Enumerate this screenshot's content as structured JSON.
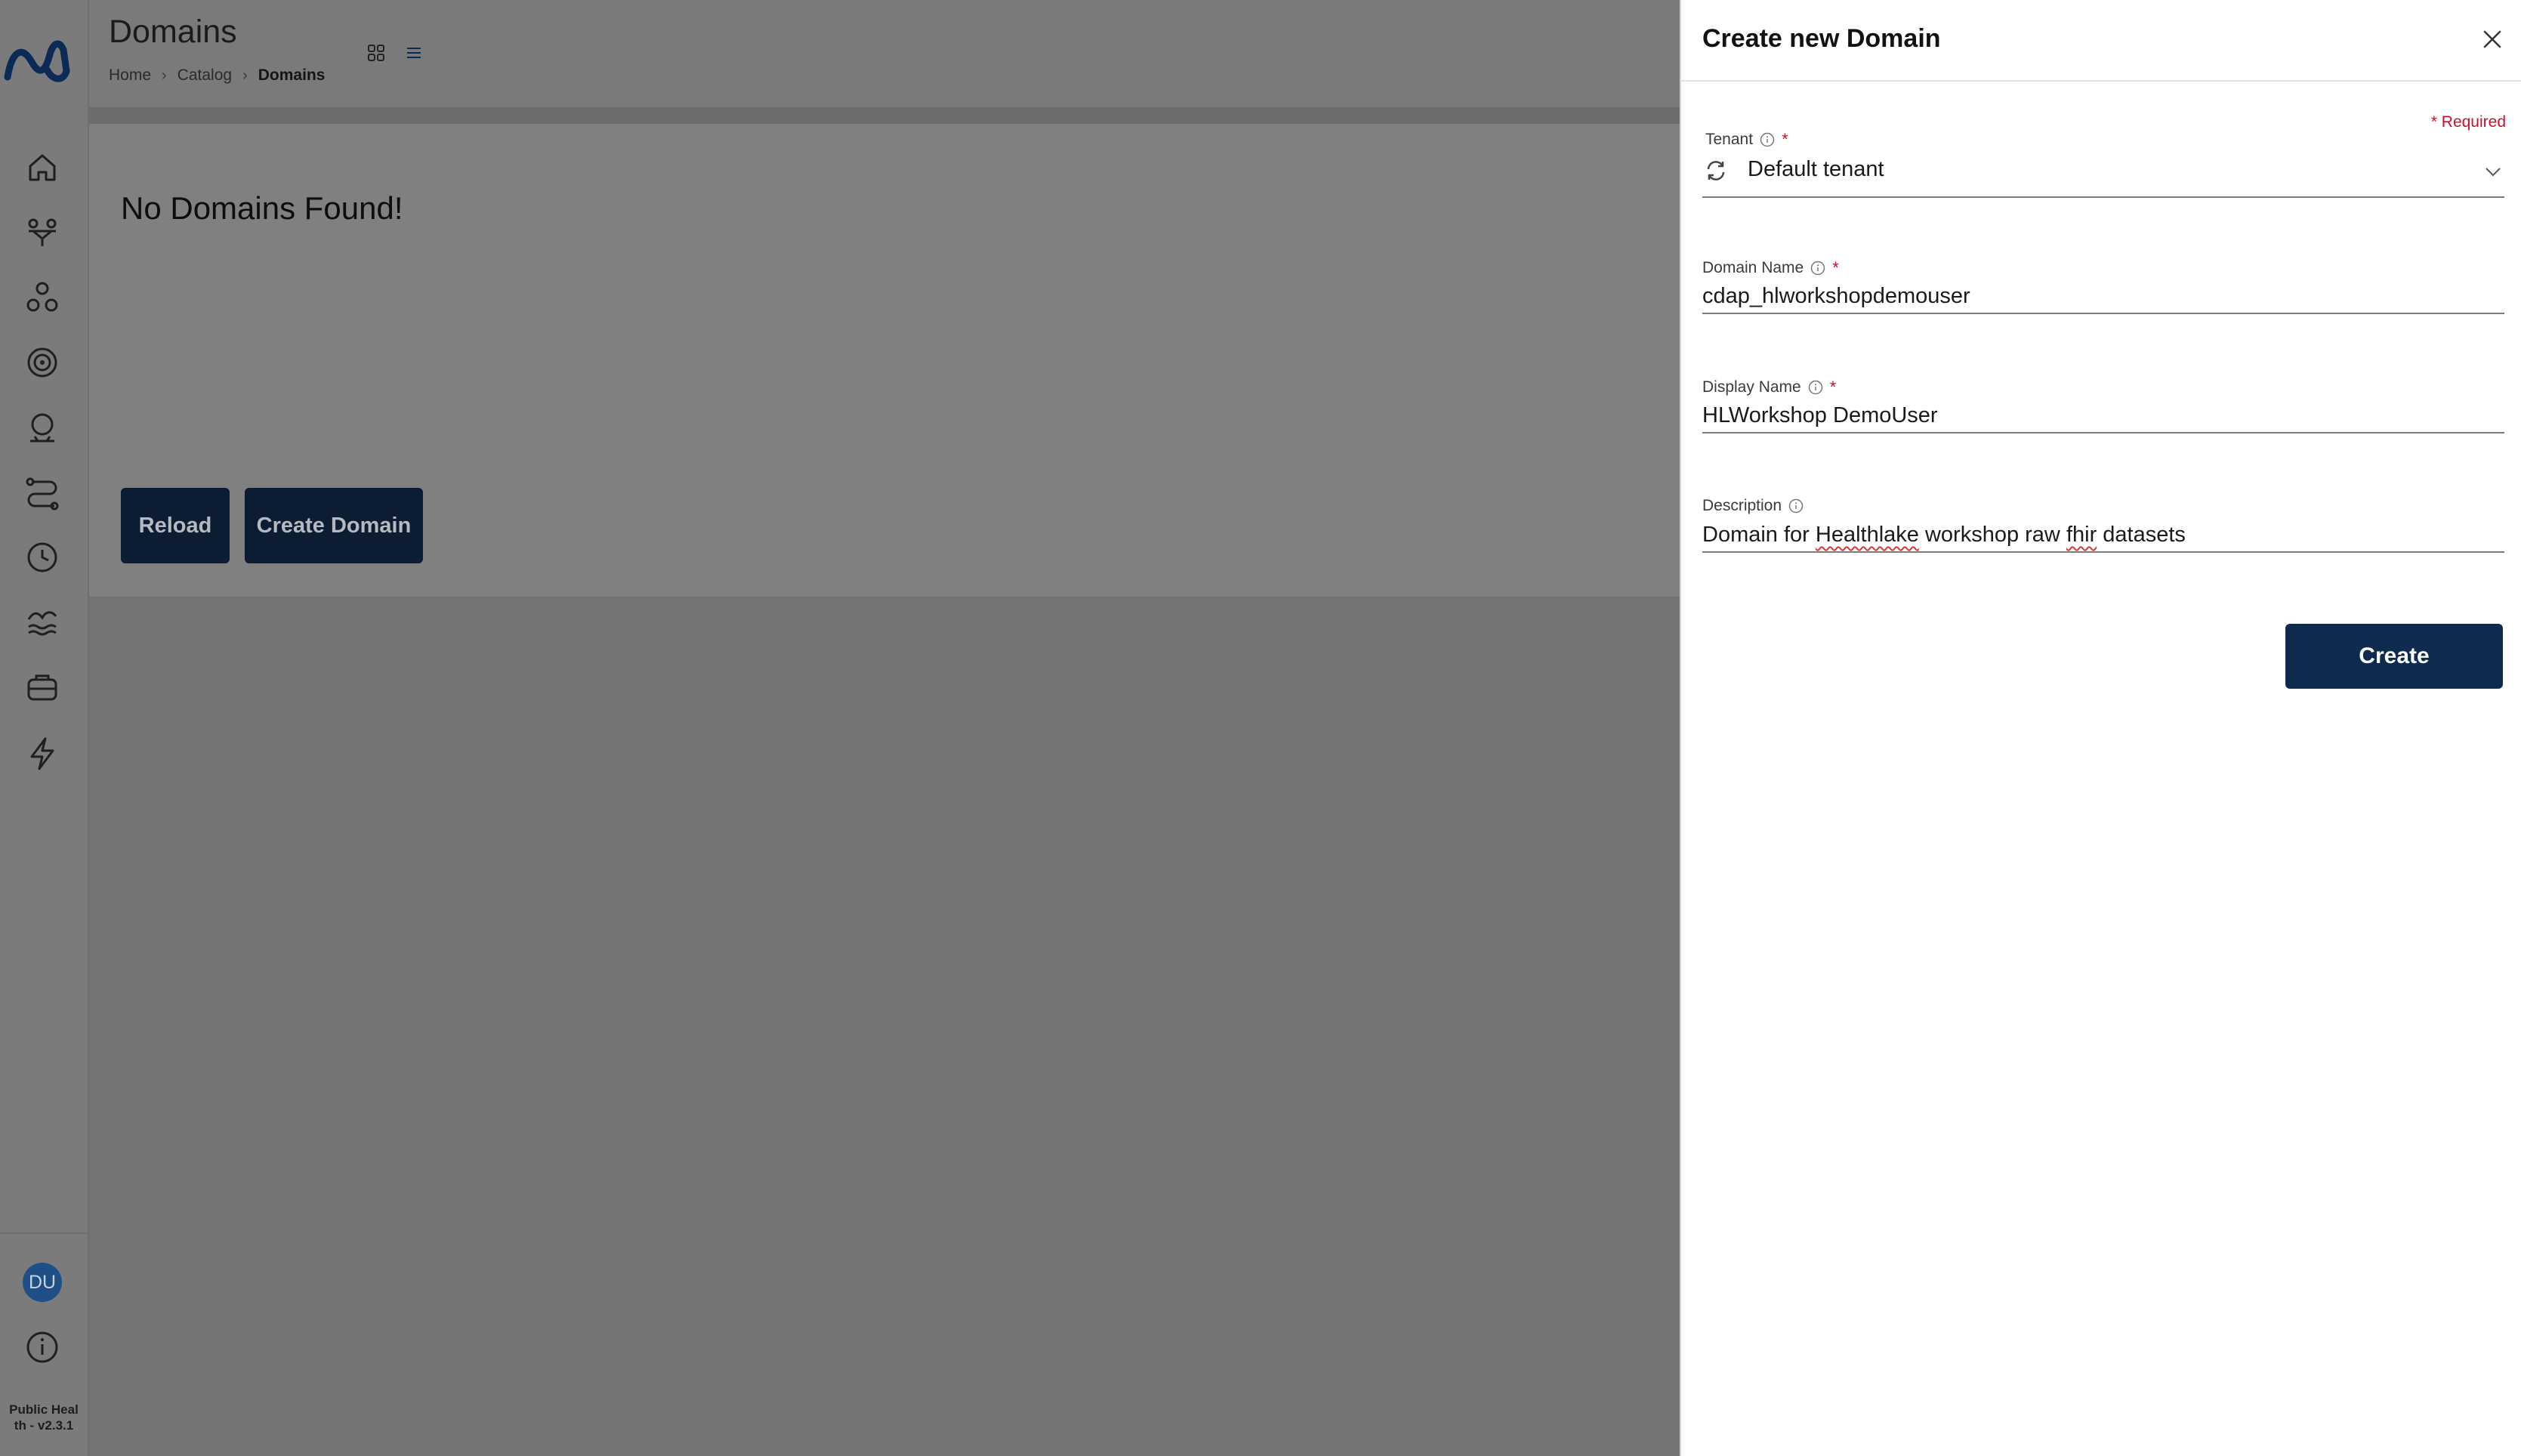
{
  "sidebar": {
    "nav_icons": [
      "home-icon",
      "data-sources-icon",
      "connections-icon",
      "governance-icon",
      "user-activity-icon",
      "pipelines-icon",
      "scheduler-icon",
      "data-lake-icon",
      "catalog-icon",
      "events-icon"
    ],
    "avatar_initials": "DU",
    "version_line1": "Public Heal",
    "version_line2": "th - v2.3.1"
  },
  "header": {
    "title": "Domains",
    "breadcrumb": [
      "Home",
      "Catalog",
      "Domains"
    ]
  },
  "main": {
    "empty_message": "No Domains Found!",
    "reload_label": "Reload",
    "create_domain_label": "Create Domain"
  },
  "drawer": {
    "title": "Create new Domain",
    "required_note": "* Required",
    "tenant": {
      "label": "Tenant",
      "value": "Default tenant"
    },
    "domain_name": {
      "label": "Domain Name",
      "value": "cdap_hlworkshopdemouser"
    },
    "display_name": {
      "label": "Display Name",
      "value": "HLWorkshop DemoUser"
    },
    "description": {
      "label": "Description",
      "value_parts": [
        "Domain for ",
        "Healthlake",
        " workshop raw ",
        "fhir",
        " datasets"
      ]
    },
    "create_label": "Create"
  },
  "colors": {
    "primary_dark": "#0e2a4e",
    "required_red": "#c8102e",
    "overlay_gray": "#7a7a7a",
    "avatar_blue": "#1e4f86"
  }
}
